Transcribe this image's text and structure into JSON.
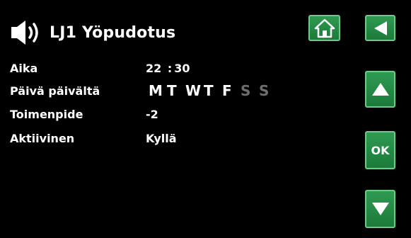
{
  "header": {
    "title": "LJ1 Yöpudotus"
  },
  "nav": {
    "ok_label": "OK"
  },
  "settings": {
    "time_label": "Aika",
    "time_hours": "22",
    "time_separator": ":",
    "time_minutes": "30",
    "days_label": "Päivä päivältä",
    "days": [
      {
        "letter": "M",
        "active": true
      },
      {
        "letter": "T",
        "active": true
      },
      {
        "letter": "W",
        "active": true
      },
      {
        "letter": "T",
        "active": true
      },
      {
        "letter": "F",
        "active": true
      },
      {
        "letter": "S",
        "active": false
      },
      {
        "letter": "S",
        "active": false
      }
    ],
    "action_label": "Toimenpide",
    "action_value": "-2",
    "active_label": "Aktiivinen",
    "active_value": "Kyllä"
  },
  "colors": {
    "background": "#000000",
    "button_green": "#2f9a52",
    "button_border": "#6fca8a",
    "text": "#ffffff",
    "inactive_day": "#6e6e6e"
  },
  "icons": [
    "speaker-icon",
    "home-icon",
    "back-arrow-icon",
    "up-arrow-icon",
    "down-arrow-icon"
  ]
}
